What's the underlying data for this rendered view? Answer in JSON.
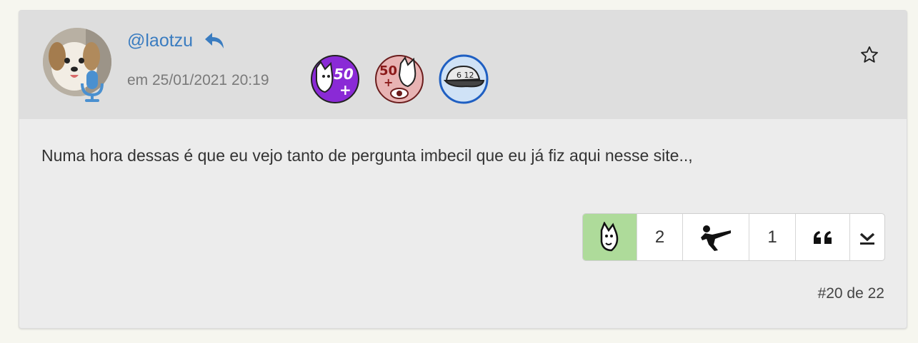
{
  "post": {
    "username": "@laotzu",
    "date": "em 25/01/2021 20:19",
    "message": "Numa hora dessas é que eu vejo tanto de pergunta imbecil que eu já fiz aqui nesse site..,",
    "post_number": "#20 de 22"
  },
  "badges": [
    {
      "name": "dog-50-plus-badge",
      "label": "50",
      "color": "#8a2ad6"
    },
    {
      "name": "dog-50-plus-eye-badge",
      "label": "50",
      "color": "#e8b3b3"
    },
    {
      "name": "cap-612-badge",
      "label": "6 12",
      "color": "#cfe2f6"
    }
  ],
  "reactions": {
    "dog_count": "2",
    "kick_count": "1"
  },
  "colors": {
    "link": "#3a7cc0",
    "active_reaction": "#aedb9a",
    "mic": "#4a90d0"
  }
}
